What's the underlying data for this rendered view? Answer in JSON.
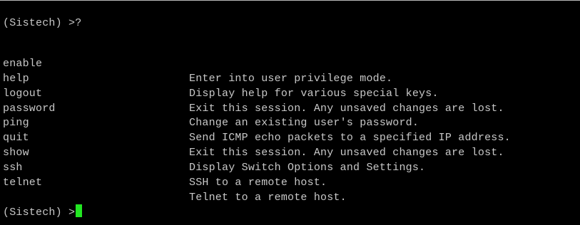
{
  "terminal": {
    "prompt_first": "(Sistech) >?",
    "commands": [
      {
        "name": "enable",
        "description": "Enter into user privilege mode."
      },
      {
        "name": "help",
        "description": "Display help for various special keys."
      },
      {
        "name": "logout",
        "description": "Exit this session. Any unsaved changes are lost."
      },
      {
        "name": "password",
        "description": "Change an existing user's password."
      },
      {
        "name": "ping",
        "description": "Send ICMP echo packets to a specified IP address."
      },
      {
        "name": "quit",
        "description": "Exit this session. Any unsaved changes are lost."
      },
      {
        "name": "show",
        "description": "Display Switch Options and Settings."
      },
      {
        "name": "ssh",
        "description": "SSH to a remote host."
      },
      {
        "name": "telnet",
        "description": "Telnet to a remote host."
      }
    ],
    "prompt_last": "(Sistech) >",
    "cursor_color": "#22e622",
    "background_color": "#000000",
    "text_color": "#c8c8c8"
  }
}
